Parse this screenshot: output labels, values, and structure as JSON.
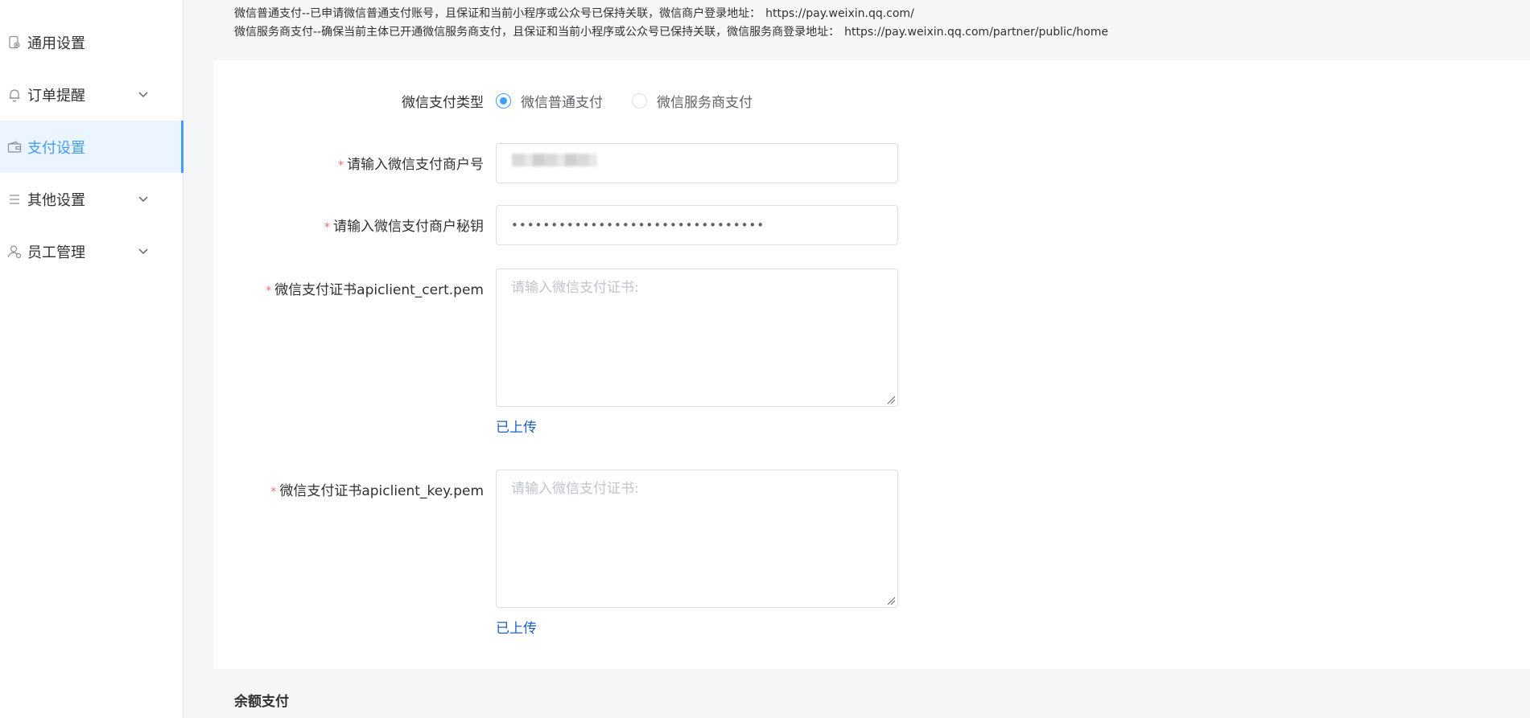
{
  "sidebar": {
    "items": [
      {
        "label": "通用设置",
        "icon": "general-settings-icon",
        "expandable": false
      },
      {
        "label": "订单提醒",
        "icon": "bell-icon",
        "expandable": true
      },
      {
        "label": "支付设置",
        "icon": "wallet-icon",
        "expandable": false,
        "active": true
      },
      {
        "label": "其他设置",
        "icon": "list-icon",
        "expandable": true
      },
      {
        "label": "员工管理",
        "icon": "user-icon",
        "expandable": true
      }
    ]
  },
  "notice": {
    "line1_text": "微信普通支付--已申请微信普通支付账号，且保证和当前小程序或公众号已保持关联，微信商户登录地址：",
    "line1_url": "https://pay.weixin.qq.com/",
    "line2_text": "微信服务商支付--确保当前主体已开通微信服务商支付，且保证和当前小程序或公众号已保持关联，微信服务商登录地址：",
    "line2_url": "https://pay.weixin.qq.com/partner/public/home"
  },
  "form": {
    "pay_type": {
      "label": "微信支付类型",
      "options": [
        "微信普通支付",
        "微信服务商支付"
      ],
      "selected": "微信普通支付"
    },
    "merchant_id": {
      "label": "请输入微信支付商户号",
      "required": true,
      "value": ""
    },
    "merchant_secret": {
      "label": "请输入微信支付商户秘钥",
      "required": true,
      "value": "••••••••••••••••••••••••••••••••"
    },
    "cert_pem": {
      "label": "微信支付证书apiclient_cert.pem",
      "required": true,
      "placeholder": "请输入微信支付证书:",
      "status": "已上传"
    },
    "key_pem": {
      "label": "微信支付证书apiclient_key.pem",
      "required": true,
      "placeholder": "请输入微信支付证书:",
      "status": "已上传"
    }
  },
  "balance": {
    "title": "余额支付"
  },
  "colors": {
    "accent": "#409eff",
    "required": "#f56c6c",
    "link": "#1f5fbf",
    "panel": "#f5f6f7"
  }
}
